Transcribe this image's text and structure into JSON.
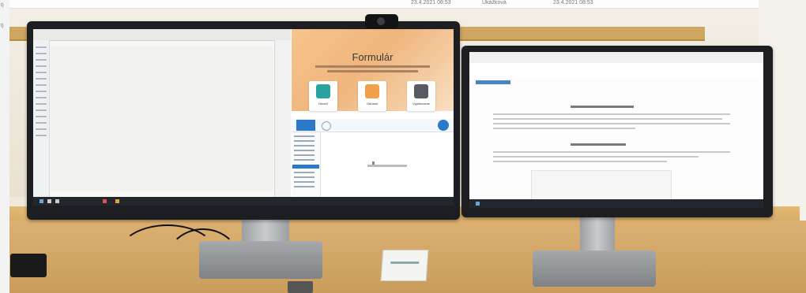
{
  "header": {
    "left_a": "t)",
    "left_b": "t)",
    "center_a": "23.4.2021 08:53",
    "center_b": "Ukážková",
    "center_c": "23.4.2021 08:53"
  },
  "left_monitor": {
    "form_app": {
      "title": "Formulár",
      "tiles": [
        {
          "label": "Otvoriť",
          "color": "#2aa3a0"
        },
        {
          "label": "Odoslať",
          "color": "#f0a04a"
        },
        {
          "label": "Vyplňovanie",
          "color": "#555b60"
        }
      ]
    }
  },
  "colors": {
    "desk": "#d2a766",
    "bezel": "#1d1e21",
    "accent": "#2b79c9"
  }
}
